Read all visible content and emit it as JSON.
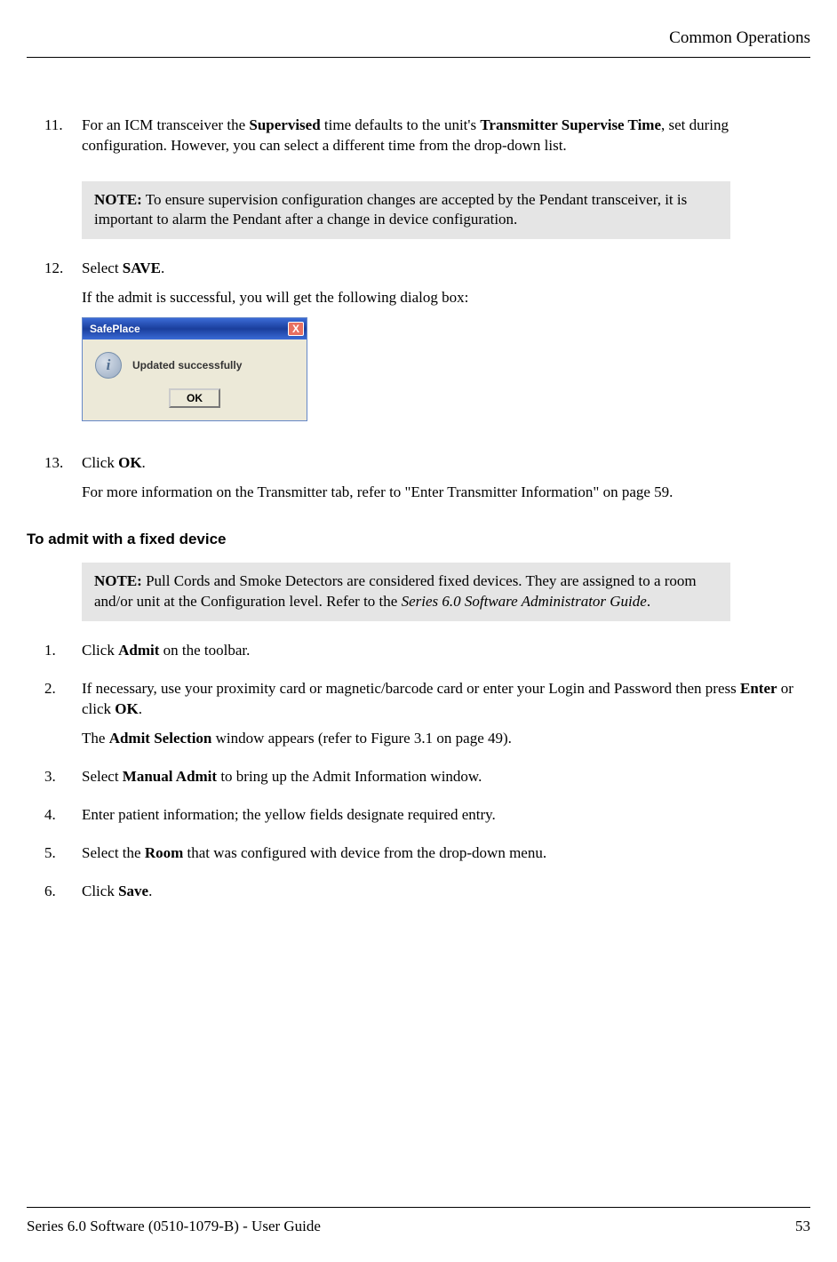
{
  "header": {
    "section": "Common Operations"
  },
  "steps_a": {
    "11": {
      "num": "11.",
      "text_pre": "For an ICM transceiver the ",
      "b1": "Supervised",
      "text_mid1": " time defaults to the unit's ",
      "b2": "Transmitter Supervise Time",
      "text_post": ", set during configuration. However, you can select a different time from the drop-down list."
    },
    "note1": {
      "label": "NOTE:",
      "text": " To ensure supervision configuration changes are accepted by the Pendant transceiver, it is important to alarm the Pendant after a change in device configuration."
    },
    "12": {
      "num": "12.",
      "line1_pre": "Select ",
      "line1_b": "SAVE",
      "line1_post": ".",
      "line2": "If the admit is successful, you will get the following dialog box:"
    },
    "dialog": {
      "title": "SafePlace",
      "close": "X",
      "icon_glyph": "i",
      "message": "Updated successfully",
      "ok": "OK"
    },
    "13": {
      "num": "13.",
      "line1_pre": "Click ",
      "line1_b": "OK",
      "line1_post": ".",
      "line2": "For more information on the Transmitter tab, refer to \"Enter Transmitter Information\" on page 59."
    }
  },
  "subhead": "To admit with a fixed device",
  "note2": {
    "label": "NOTE:",
    "text_a": " Pull Cords and Smoke Detectors are considered fixed devices. They are assigned to a room and/or unit at the Configuration level. Refer to the ",
    "italic": "Series 6.0 Software Administrator Guide",
    "text_b": "."
  },
  "steps_b": {
    "1": {
      "num": "1.",
      "pre": "Click ",
      "b": "Admit",
      "post": " on the toolbar."
    },
    "2": {
      "num": "2.",
      "line1_a": "If necessary, use your proximity card or magnetic/barcode card or enter your Login and Password then press ",
      "b1": "Enter",
      "line1_b": " or click ",
      "b2": "OK",
      "line1_c": ".",
      "line2_a": "The ",
      "b3": "Admit Selection",
      "line2_b": " window appears (refer to Figure 3.1 on page 49)."
    },
    "3": {
      "num": "3.",
      "pre": "Select ",
      "b": "Manual Admit",
      "post": " to bring up the Admit Information window."
    },
    "4": {
      "num": "4.",
      "text": "Enter patient information; the yellow fields designate required entry."
    },
    "5": {
      "num": "5.",
      "pre": "Select the ",
      "b": "Room",
      "post": " that was configured with device from the drop-down menu."
    },
    "6": {
      "num": "6.",
      "pre": "Click ",
      "b": "Save",
      "post": "."
    }
  },
  "footer": {
    "left": "Series 6.0 Software (0510-1079-B) - User Guide",
    "right": "53"
  }
}
